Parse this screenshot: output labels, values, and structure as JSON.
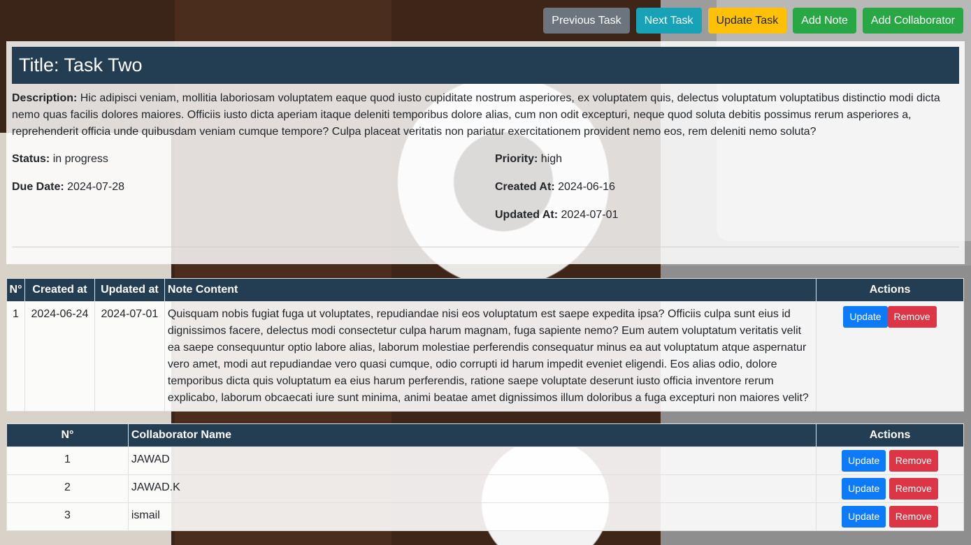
{
  "toolbar": {
    "previous_label": "Previous Task",
    "next_label": "Next Task",
    "update_label": "Update Task",
    "add_note_label": "Add Note",
    "add_collaborator_label": "Add Collaborator"
  },
  "task": {
    "title": "Title: Task Two",
    "description_label": "Description:",
    "description": "Hic adipisci veniam, mollitia laboriosam voluptatem eaque quod iusto cupiditate nostrum asperiores, ex voluptatem quis, delectus voluptatum voluptatibus distinctio modi dicta nemo quas facilis dolores maiores. Officiis iusto dicta aperiam itaque deleniti temporibus dolore alias, cum non odit excepturi, neque quod soluta debitis possimus rerum asperiores a, reprehenderit officia unde quibusdam veniam cumque tempore? Culpa placeat veritatis non pariatur exercitationem provident nemo eos, rem deleniti nemo soluta?",
    "status_label": "Status:",
    "status": "in progress",
    "due_label": "Due Date:",
    "due": "2024-07-28",
    "priority_label": "Priority:",
    "priority": "high",
    "created_label": "Created At:",
    "created": "2024-06-16",
    "updated_label": "Updated At:",
    "updated": "2024-07-01"
  },
  "notes": {
    "headers": [
      "N°",
      "Created at",
      "Updated at",
      "Note Content",
      "Actions"
    ],
    "rows": [
      {
        "n": "1",
        "created": "2024-06-24",
        "updated": "2024-07-01",
        "content": "Quisquam nobis fugiat fuga ut voluptates, repudiandae nisi eos voluptatum est saepe expedita ipsa? Officiis culpa sunt eius id dignissimos facere, delectus modi consectetur culpa harum magnam, fuga sapiente nemo? Eum autem voluptatum veritatis velit ea saepe consequuntur optio labore alias, laborum molestiae perferendis consequatur minus ea aut voluptatum atque aspernatur vero amet, modi aut repudiandae vero quasi cumque, odio corrupti id harum impedit eveniet eligendi. Eos alias odio, dolore temporibus dicta quis voluptatum ea eius harum perferendis, ratione saepe voluptate deserunt iusto officia inventore rerum explicabo, laborum obcaecati iure sunt minima, animi beatae amet dignissimos illum doloribus a fuga excepturi non maiores velit?"
      }
    ]
  },
  "collaborators": {
    "headers": [
      "N°",
      "Collaborator Name",
      "Actions"
    ],
    "rows": [
      {
        "n": "1",
        "name": "JAWAD"
      },
      {
        "n": "2",
        "name": "JAWAD.K"
      },
      {
        "n": "3",
        "name": "ismail"
      }
    ]
  },
  "actions": {
    "update_label": "Update",
    "remove_label": "Remove"
  },
  "colors": {
    "header_bg": "#233d52",
    "primary": "#0d7bf7",
    "danger": "#dc3545",
    "success": "#28a745",
    "warning": "#ffc107",
    "info": "#17a2b8",
    "secondary": "#6c757d"
  }
}
